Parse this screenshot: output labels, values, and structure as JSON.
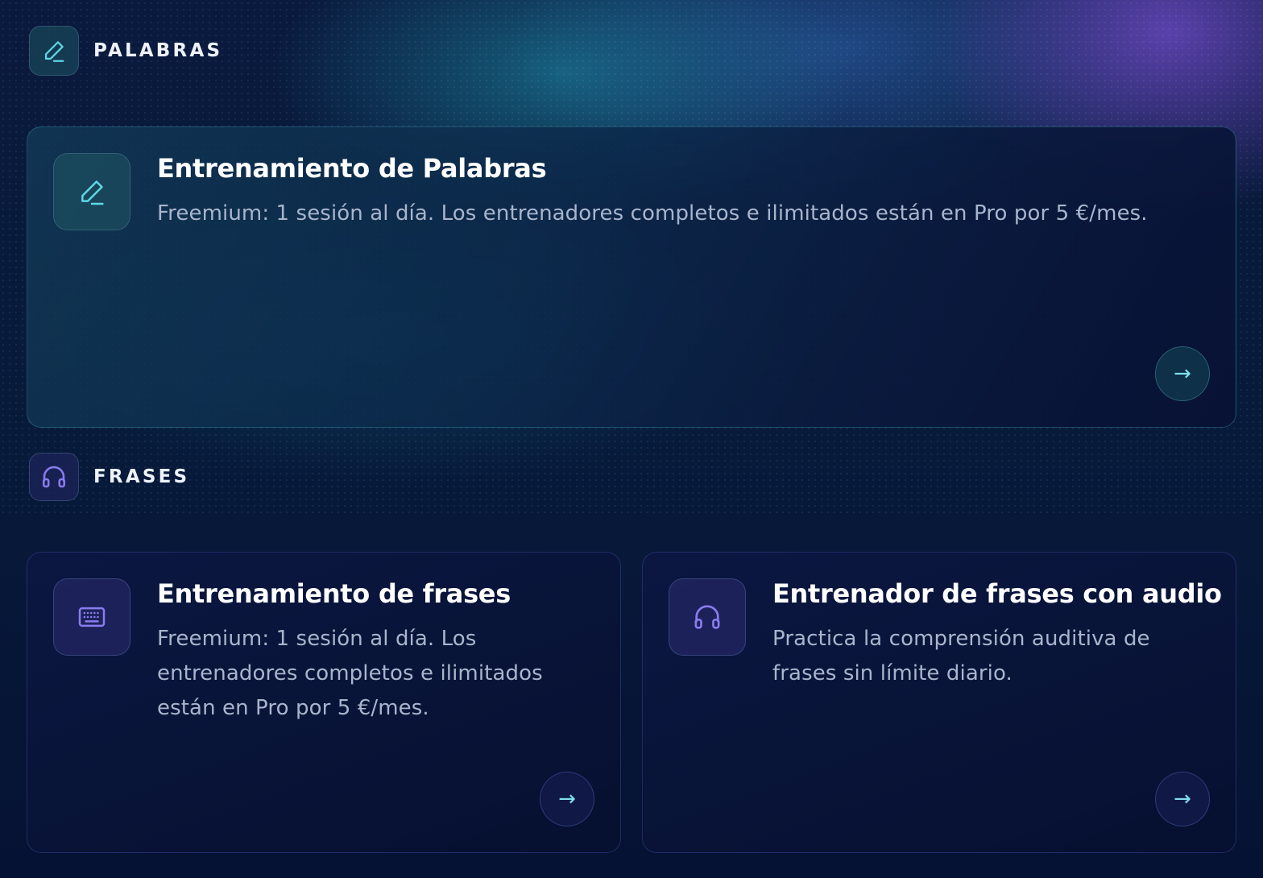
{
  "sections": [
    {
      "title": "PALABRAS",
      "icon": "pencil-icon",
      "accent": "#5fd6e6",
      "cards": [
        {
          "title": "Entrenamiento de Palabras",
          "description": "Freemium: 1 sesión al día. Los entrenadores completos e ilimitados están en Pro por 5 €/mes.",
          "icon": "pencil-icon",
          "action": "→"
        }
      ]
    },
    {
      "title": "FRASES",
      "icon": "headphones-icon",
      "accent": "#8a7cf0",
      "cards": [
        {
          "title": "Entrenamiento de frases",
          "description": "Freemium: 1 sesión al día. Los entrenadores completos e ilimitados están en Pro por 5 €/mes.",
          "icon": "keyboard-icon",
          "action": "→"
        },
        {
          "title": "Entrenador de frases con audio",
          "description": "Practica la comprensión auditiva de frases sin límite diario.",
          "icon": "headphones-icon",
          "action": "→"
        }
      ]
    }
  ]
}
